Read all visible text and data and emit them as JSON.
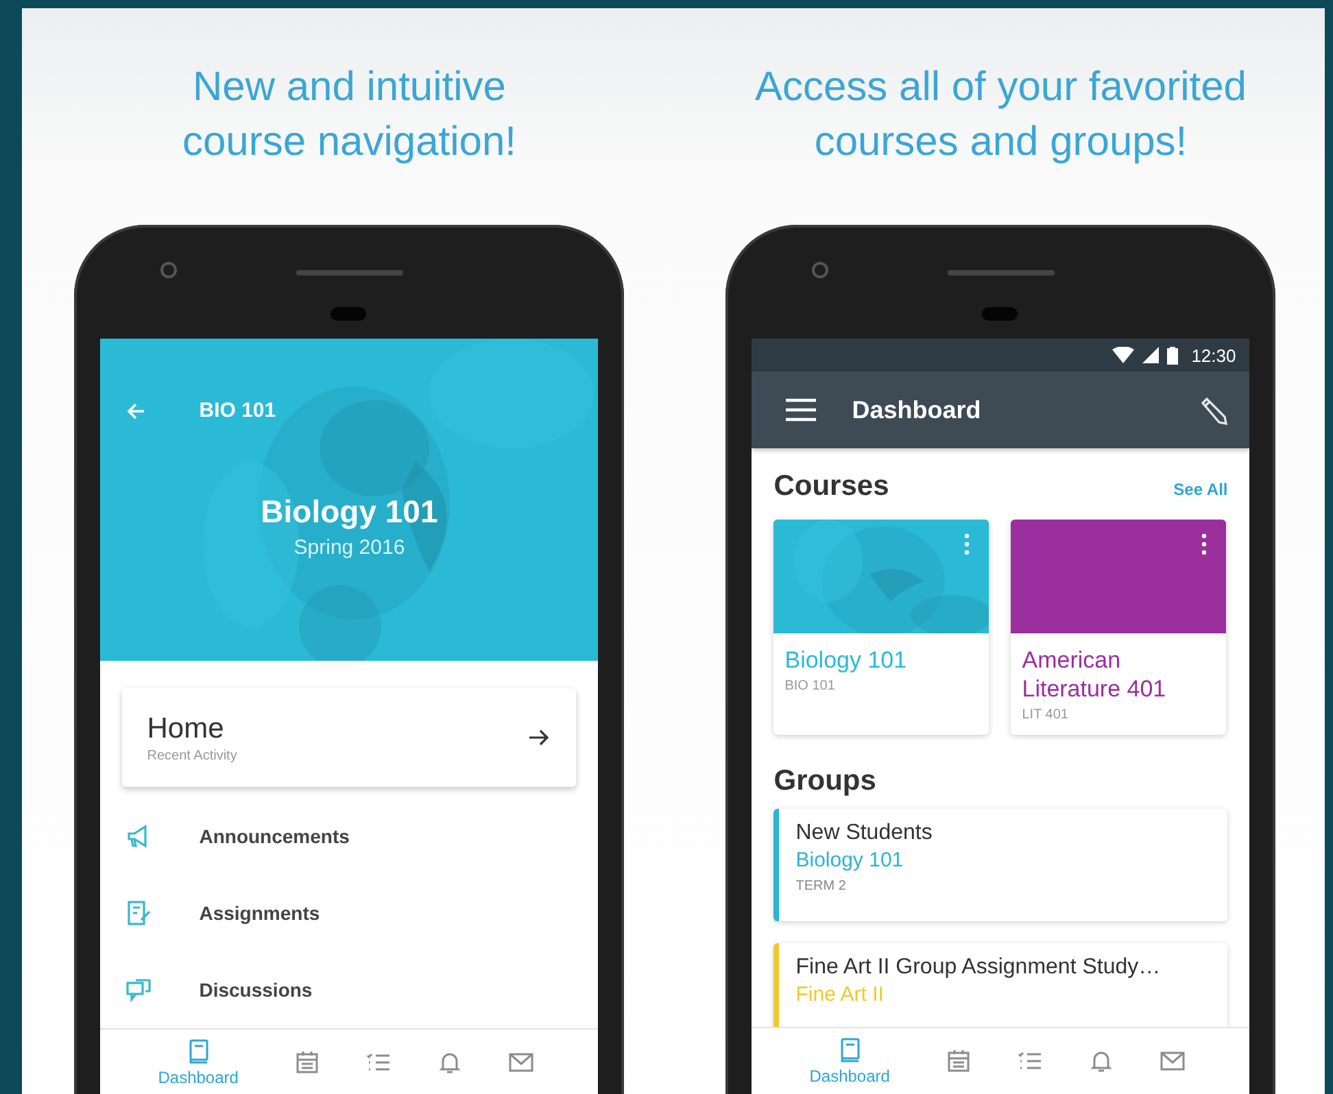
{
  "course_panel": {
    "headline_lines": [
      "New and intuitive",
      "course navigation!"
    ],
    "screen": {
      "back_label": "BIO 101",
      "title": "Biology 101",
      "subtitle": "Spring 2016",
      "home_card": {
        "title": "Home",
        "subtitle": "Recent Activity"
      },
      "menu_items": [
        {
          "label": "Announcements"
        },
        {
          "label": "Assignments"
        },
        {
          "label": "Discussions"
        }
      ],
      "bottom_nav": [
        {
          "label": "Dashboard",
          "selected": true
        },
        {
          "selected": false
        },
        {
          "selected": false
        },
        {
          "selected": false
        },
        {
          "selected": false
        }
      ]
    }
  },
  "dashboard_panel": {
    "headline_lines": [
      "Access all of your favorited",
      "courses and groups!"
    ],
    "screen": {
      "status_time": "12:30",
      "title": "Dashboard",
      "courses_heading": "Courses",
      "see_all": "See All",
      "courses": [
        {
          "name": "Biology 101",
          "code": "BIO 101",
          "color": "#2bbad6",
          "kind": "picture"
        },
        {
          "name": "American Literature 401",
          "code": "LIT 401",
          "color": "#9b2f9e",
          "kind": "plain"
        }
      ],
      "groups_heading": "Groups",
      "groups": [
        {
          "name": "New Students",
          "course": "Biology 101",
          "term": "TERM 2",
          "color": "#2bb3d4"
        },
        {
          "name": "Fine Art II Group Assignment Study…",
          "course": "Fine Art II",
          "color": "#f0c92e"
        }
      ],
      "bottom_nav": [
        {
          "label": "Dashboard",
          "selected": true
        },
        {
          "selected": false
        },
        {
          "selected": false
        },
        {
          "selected": false
        },
        {
          "selected": false
        }
      ]
    }
  }
}
